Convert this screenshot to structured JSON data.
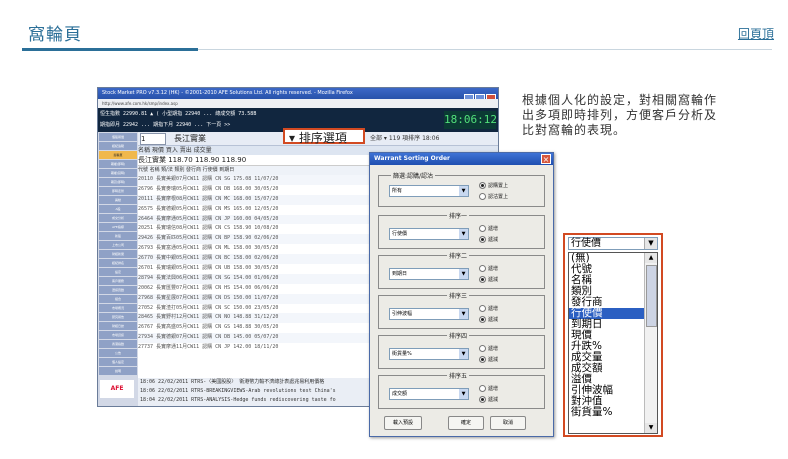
{
  "header": {
    "title": "窩輪頁",
    "back_link": "回頁頂"
  },
  "description": "根據個人化的設定，對相關窩輪作出多項即時排列，方便客戶分析及比對窩輪的表現。",
  "window": {
    "title": "Stock Market PRO v7.3.12 (HK) - ©2001-2010 AFE Solutions Ltd. All rights reserved. - Mozilla Firefox",
    "url": "http://www.afe.com.hk/smp/index.asp",
    "clock": "18:06:12",
    "ticker_row1": "恒生指數 22990.81   ▲  ( 小型期指 22940 ... 總成交額 73.58B",
    "ticker_row2": "期指即月 22942 ... 期指下月 22940 ... 下一頁 >>",
    "toolbar": {
      "stock_num": "1",
      "stock_name": "長江實業",
      "sort_button": "排序選項",
      "right_info": "全部 ▾ 119 項排序 18:06"
    },
    "group_header": "名稱       現價   買入   賣出   成交量",
    "selected_row": "長江實業        118.70   118.90   118.90",
    "columns": "代號  名稱          類/法  類別  發行商  行使價  到期日",
    "rows": [
      "20110 長實美銀07月CW11 認購 CN SG 175.08 11/07/20",
      "26796 長實麥瑞05月CW11 認購 CN DB 168.00 30/05/20",
      "20111 長實摩根08月CW11 認購 CN MC 168.00 15/07/20",
      "26575 長實德銀05月CW11 認購 CN MS 165.00 12/05/20",
      "26464 長實摩通05月CW11 認購 CN JP 160.00 04/05/20",
      "20251 長實瑞信08月CW11 認購 CN CS 158.90 10/08/20",
      "29426 長實百匹05月CW11 認購 CN BP 158.90 02/06/20",
      "26793 長實富通05月CW11 認購 CN ML 158.00 30/05/20",
      "26770 長實中銀05月CW11 認購 CN BC 158.00 02/06/20",
      "26701 長實瑞銀05月CW11 認購 CN UB 158.00 30/05/20",
      "28794 長實法興06月CW11 認購 CN SG 154.00 01/06/20",
      "20062 長實匯豐07月CW11 認購 CN HS 154.00 06/06/20",
      "27968 長實星展07月CW11 認購 CN DS 150.00 11/07/20",
      "27052 長實渣打05月CW11 認購 CN SC 150.00 23/05/20",
      "28465 長實野村12月CW11 認購 CN NO 148.88 31/12/20",
      "26767 長實高盛05月CW11 認購 CN GS 148.88 30/05/20",
      "27934 長實德銀07月CW11 認購 CN DB 145.00 05/07/20",
      "27737 長實摩通11月CW11 認購 CN JP 142.00 18/11/20"
    ],
    "news": [
      "18:06 22/02/2011 RTRS-〈美國股股〉 衛港幣力輸不濟總計表處兆易利用價格",
      "18:06 22/02/2011 RTRS-BREAKINGVIEWS-Arab revolutions test China's",
      "18:04 22/02/2011 RTRS-ANALYSIS-Hedge funds rediscovering taste fo"
    ],
    "sidebar": [
      "個股報價",
      "經紀追蹤",
      "窩輪頁",
      "期權(即時)",
      "期權(延時)",
      "期貨(即時)",
      "即時走勢",
      "異動",
      "A股",
      "成交分析",
      "AFE指標",
      "新股",
      "上市公司",
      "財經新聞",
      "經紀排名",
      "設定",
      "客戶服務",
      "選擇頁數",
      "組合",
      "市場概況",
      "研究報告",
      "財經日誌",
      "市場資訊",
      "香港指數",
      "公告",
      "個人設定",
      "說明"
    ],
    "sidebar_active_index": 2,
    "logo": "AFE"
  },
  "dialog": {
    "title": "Warrant Sorting Order",
    "filter_group": "篩選:認購/認沽",
    "filter_value": "所有",
    "filter_radio_1": "認購置上",
    "filter_radio_2": "認沽置上",
    "groups": [
      {
        "label": "排序一",
        "value": "行使價"
      },
      {
        "label": "排序二",
        "value": "到期日"
      },
      {
        "label": "排序三",
        "value": "引伸波幅"
      },
      {
        "label": "排序四",
        "value": "街貨量%"
      },
      {
        "label": "排序五",
        "value": "成交額"
      }
    ],
    "asc": "遞增",
    "desc": "遞減",
    "btn_load": "載入預設",
    "btn_ok": "確定",
    "btn_cancel": "取消"
  },
  "dropdown": {
    "current": "行使價",
    "options": [
      "(無)",
      "代號",
      "名稱",
      "類別",
      "發行商",
      "行使價",
      "到期日",
      "現價",
      "升跌%",
      "成交量",
      "成交額",
      "溢價",
      "引伸波幅",
      "對沖值",
      "街貨量%"
    ],
    "selected_index": 5
  }
}
